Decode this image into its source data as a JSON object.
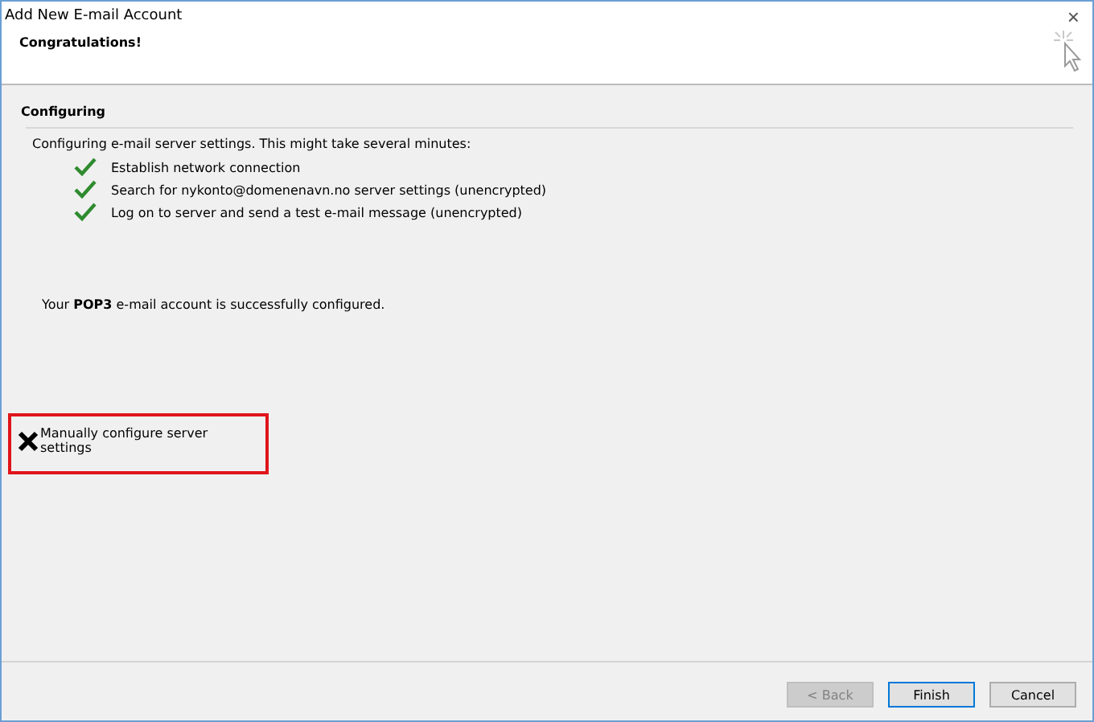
{
  "window": {
    "title": "Add New E-mail Account",
    "close": "×"
  },
  "header": {
    "title": "Congratulations!"
  },
  "section": {
    "title": "Configuring",
    "intro": "Configuring e-mail server settings. This might take several minutes:",
    "steps": [
      {
        "label": "Establish network connection",
        "done": true
      },
      {
        "label": "Search for nykonto@domenenavn.no server settings (unencrypted)",
        "done": true
      },
      {
        "label": "Log on to server and send a test e-mail message (unencrypted)",
        "done": true
      }
    ]
  },
  "result": "Your **POP3** e-mail account is successfully configured.",
  "manual": {
    "label": "Manually configure server settings",
    "checked": true,
    "highlighted": true
  },
  "buttons": [
    {
      "label": "< Back",
      "disabled": true,
      "default": false
    },
    {
      "label": "Finish",
      "disabled": false,
      "default": true
    },
    {
      "label": "Cancel",
      "disabled": false,
      "default": false
    }
  ]
}
